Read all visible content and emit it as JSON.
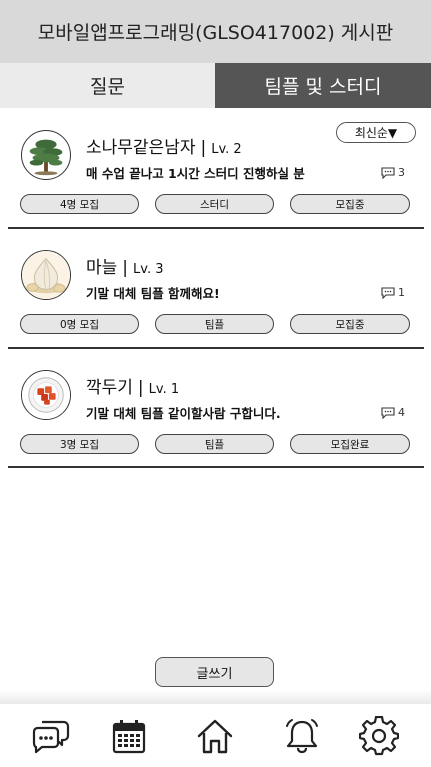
{
  "header": {
    "title": "모바일앱프로그래밍(GLSO417002) 게시판"
  },
  "tabs": [
    {
      "label": "질문",
      "active": false
    },
    {
      "label": "팀플 및 스터디",
      "active": true
    }
  ],
  "sort": {
    "label": "최신순▼"
  },
  "posts": [
    {
      "author": "소나무같은남자",
      "level": "Lv. 2",
      "title": "매 수업 끝나고 1시간 스터디 진행하실 분",
      "comment_count": "3",
      "recruit_count": "4명 모집",
      "category": "스터디",
      "status": "모집중",
      "avatar_icon": "pine-tree-icon"
    },
    {
      "author": "마늘",
      "level": "Lv. 3",
      "title": "기말 대체 팀플 함께해요!",
      "comment_count": "1",
      "recruit_count": "0명 모집",
      "category": "팀플",
      "status": "모집중",
      "avatar_icon": "garlic-icon"
    },
    {
      "author": "깍두기",
      "level": "Lv. 1",
      "title": "기말 대체 팀플 같이할사람 구합니다.",
      "comment_count": "4",
      "recruit_count": "3명 모집",
      "category": "팀플",
      "status": "모집완료",
      "avatar_icon": "kimchi-bowl-icon"
    }
  ],
  "write_button": {
    "label": "글쓰기"
  },
  "bottom_nav": [
    {
      "icon": "chat-bubbles-icon"
    },
    {
      "icon": "calendar-icon"
    },
    {
      "icon": "home-icon"
    },
    {
      "icon": "bell-icon"
    },
    {
      "icon": "gear-icon"
    }
  ],
  "colors": {
    "header_bg": "#d9d9d9",
    "active_tab_bg": "#555555",
    "inactive_tab_bg": "#ebebeb",
    "chip_bg": "#e6e6e6"
  }
}
